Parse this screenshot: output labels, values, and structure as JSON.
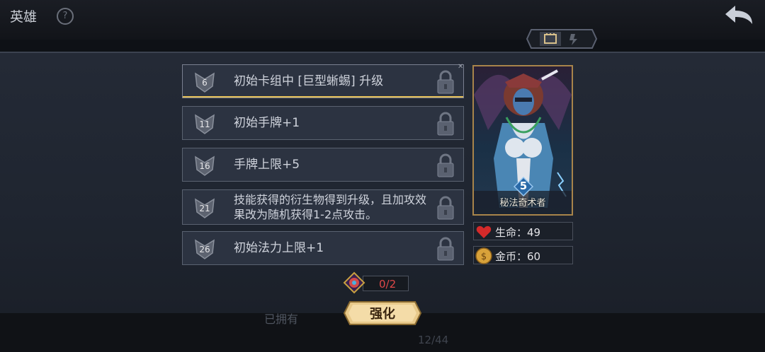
{
  "header": {
    "title": "英雄",
    "help_icon": "?"
  },
  "talents": [
    {
      "level": "6",
      "text": "初始卡组中 [巨型蜥蜴] 升级"
    },
    {
      "level": "11",
      "text": "初始手牌+1"
    },
    {
      "level": "16",
      "text": "手牌上限+5"
    },
    {
      "level": "21",
      "text": "技能获得的衍生物得到升级，且加攻效果改为随机获得1-2点攻击。"
    },
    {
      "level": "26",
      "text": "初始法力上限+1"
    }
  ],
  "hero": {
    "name": "秘法奇术者",
    "level": "5",
    "hp_label": "生命：49",
    "gold_label": "金币：60"
  },
  "resource": {
    "value": "0/2"
  },
  "enhance_button": {
    "label": "强化"
  },
  "footer": {
    "owned_label": "已拥有",
    "page": "12/44"
  },
  "colors": {
    "gold": "#e6c25a",
    "resource_red": "#e04848",
    "panel": "#242a36"
  }
}
